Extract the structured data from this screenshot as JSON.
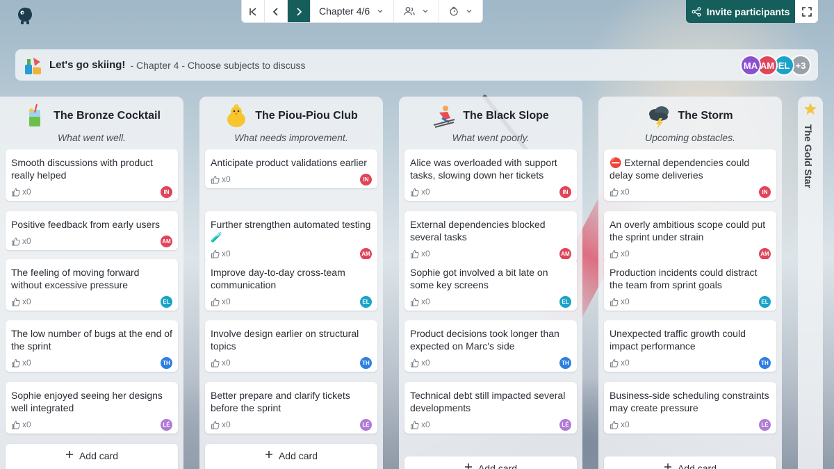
{
  "toolbar": {
    "chapter": "Chapter 4/6",
    "invite_label": "Invite participants"
  },
  "session": {
    "title": "Let's go skiing!",
    "subtitle": "- Chapter 4 - Choose subjects to discuss",
    "participants": [
      {
        "initials": "MA",
        "color": "#8a4fd1"
      },
      {
        "initials": "AM",
        "color": "#e0455a"
      },
      {
        "initials": "EL",
        "color": "#1aa3c8"
      }
    ],
    "more": "+3"
  },
  "colors": {
    "accent": "#155e5c",
    "IN": "#e0455a",
    "AM": "#e0455a",
    "EL": "#1aa3c8",
    "TH": "#2f7fe0",
    "LE": "#b07ad6"
  },
  "columns": [
    {
      "title": "The Bronze Cocktail",
      "subtitle": "What went well.",
      "icon": "cocktail-icon",
      "cards": [
        {
          "text": "Smooth discussions with product really helped",
          "likes": "x0",
          "user": "IN"
        },
        {
          "text": "Positive feedback from early users",
          "likes": "x0",
          "user": "AM"
        },
        {
          "text": "The feeling of moving forward without excessive pressure",
          "likes": "x0",
          "user": "EL"
        },
        {
          "text": "The low number of bugs at the end of the sprint",
          "likes": "x0",
          "user": "TH"
        },
        {
          "text": "Sophie enjoyed seeing her designs well integrated",
          "likes": "x0",
          "user": "LÉ"
        }
      ],
      "add_label": "Add card"
    },
    {
      "title": "The Piou-Piou Club",
      "subtitle": "What needs improvement.",
      "icon": "chick-icon",
      "cards": [
        {
          "text": "Anticipate product validations earlier",
          "likes": "x0",
          "user": "IN"
        },
        {
          "text": "Further strengthen automated testing 🧪",
          "likes": "x0",
          "user": "AM"
        },
        {
          "text": "Improve day-to-day cross-team communication",
          "likes": "x0",
          "user": "EL"
        },
        {
          "text": "Involve design earlier on structural topics",
          "likes": "x0",
          "user": "TH"
        },
        {
          "text": "Better prepare and clarify tickets before the sprint",
          "likes": "x0",
          "user": "LÉ"
        }
      ],
      "add_label": "Add card"
    },
    {
      "title": "The Black Slope",
      "subtitle": "What went poorly.",
      "icon": "skier-icon",
      "cards": [
        {
          "text": "Alice was overloaded with support tasks, slowing down her tickets",
          "likes": "x0",
          "user": "IN"
        },
        {
          "text": "External dependencies blocked several tasks",
          "likes": "x0",
          "user": "AM"
        },
        {
          "text": "Sophie got involved a bit late on some key screens",
          "likes": "x0",
          "user": "EL"
        },
        {
          "text": "Product decisions took longer than expected on Marc's side",
          "likes": "x0",
          "user": "TH"
        },
        {
          "text": "Technical debt still impacted several developments",
          "likes": "x0",
          "user": "LÉ"
        }
      ],
      "add_label": "Add card"
    },
    {
      "title": "The Storm",
      "subtitle": "Upcoming obstacles.",
      "icon": "storm-cloud-icon",
      "cards": [
        {
          "text": "⛔ External dependencies could delay some deliveries",
          "likes": "x0",
          "user": "IN"
        },
        {
          "text": "An overly ambitious scope could put the sprint under strain",
          "likes": "x0",
          "user": "AM"
        },
        {
          "text": "Production incidents could distract the team from sprint goals",
          "likes": "x0",
          "user": "EL"
        },
        {
          "text": "Unexpected traffic growth could impact performance",
          "likes": "x0",
          "user": "TH"
        },
        {
          "text": "Business-side scheduling constraints may create pressure",
          "likes": "x0",
          "user": "LÉ"
        }
      ],
      "add_label": "Add card"
    }
  ],
  "side_column": {
    "title": "The Gold Star",
    "icon": "star-icon"
  }
}
